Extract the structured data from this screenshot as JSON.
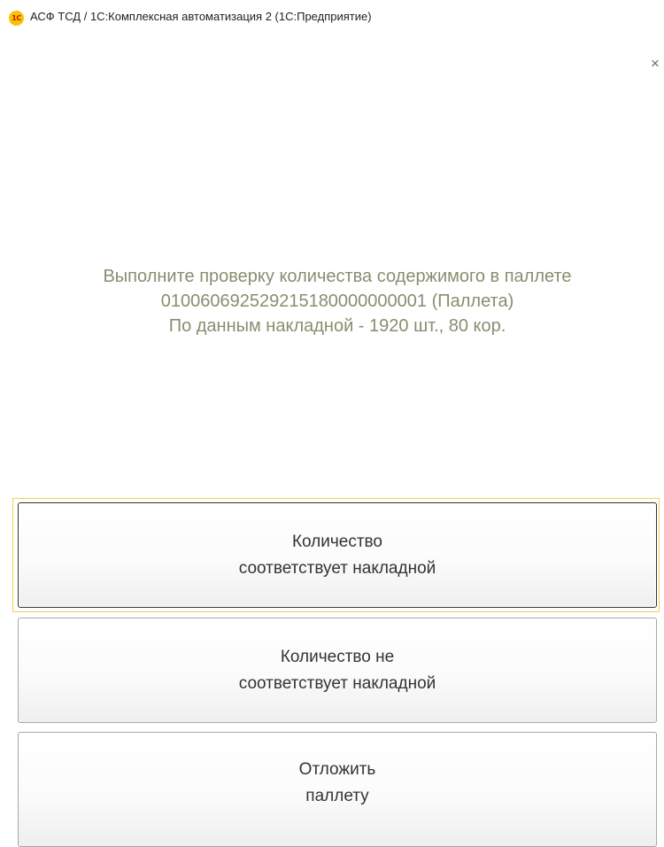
{
  "window": {
    "app_icon_text": "1С",
    "title": "АСФ ТСД / 1С:Комплексная автоматизация 2  (1С:Предприятие)",
    "close_symbol": "×"
  },
  "message": {
    "line1": "Выполните проверку количества содержимого в паллете",
    "line2": "010060692529215180000000001 (Паллета)",
    "line3": "По данным накладной - 1920 шт., 80 кор."
  },
  "buttons": {
    "match": {
      "line1": "Количество",
      "line2": "соответствует накладной"
    },
    "mismatch": {
      "line1": "Количество не",
      "line2": "соответствует накладной"
    },
    "postpone": {
      "line1": "Отложить",
      "line2": "паллету"
    }
  },
  "colors": {
    "message_text": "#8c8c70",
    "focus_border": "#f3cf57",
    "button_border": "#a7a7a7",
    "app_icon_bg": "#f5c400",
    "app_icon_fg": "#d01010"
  }
}
